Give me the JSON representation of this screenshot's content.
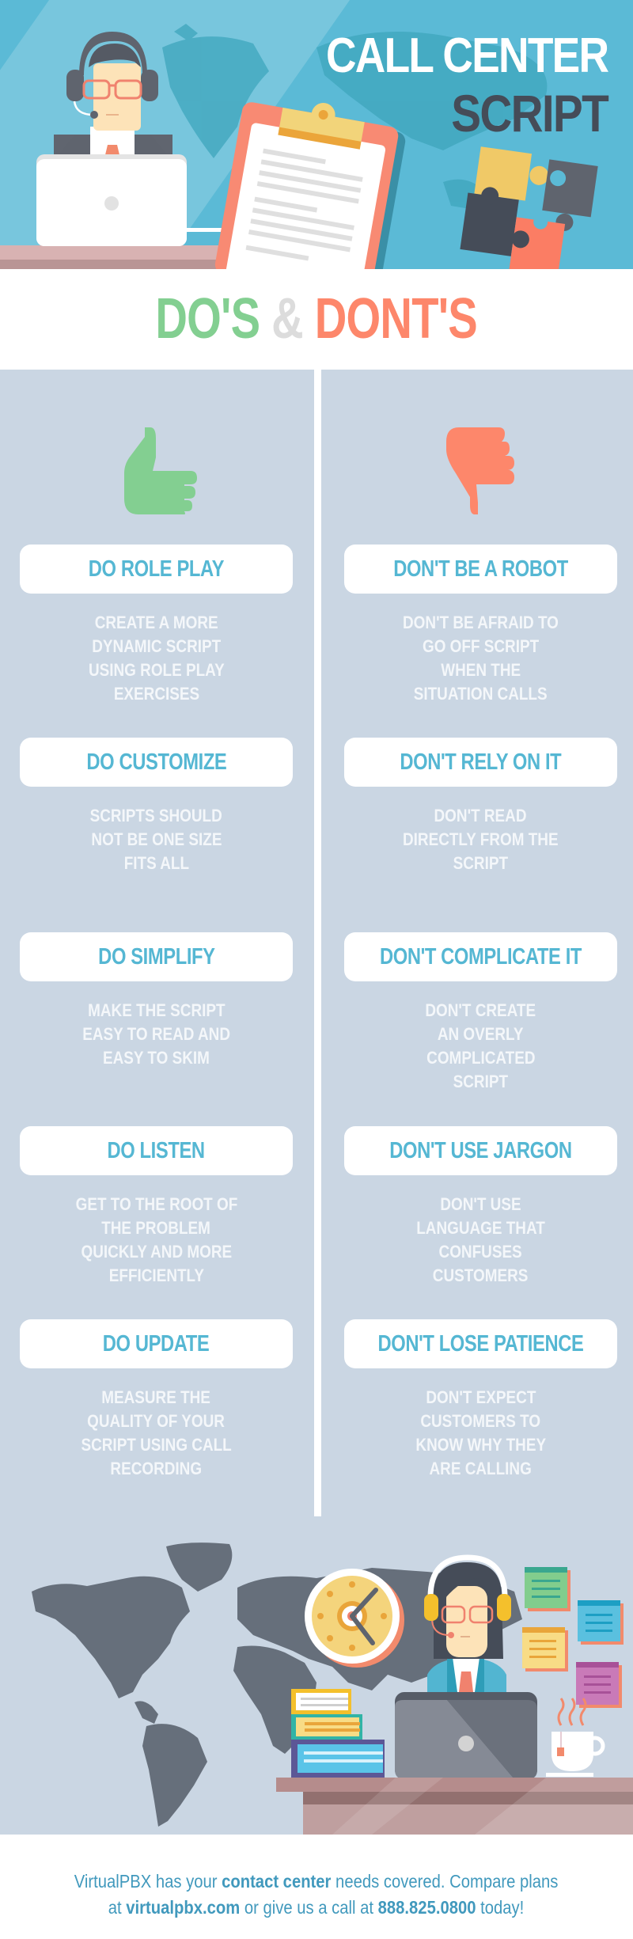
{
  "header": {
    "title_line1": "CALL CENTER",
    "title_line2": "SCRIPT"
  },
  "subheading": {
    "dos": "DO'S",
    "amp": "&",
    "donts": "DONT'S"
  },
  "icons": {
    "left": "thumbs-up-icon",
    "right": "thumbs-down-icon"
  },
  "colors": {
    "header_bg": "#5bbad6",
    "dos_green": "#83cf91",
    "donts_coral": "#fd876b",
    "card_text": "#55b7d3",
    "panel_bg": "#cad6e3",
    "footer_text": "#4199bd"
  },
  "dos": [
    {
      "title": "DO ROLE PLAY",
      "lines": [
        "CREATE A MORE",
        "DYNAMIC SCRIPT",
        "USING ROLE PLAY",
        "EXERCISES"
      ]
    },
    {
      "title": "DO CUSTOMIZE",
      "lines": [
        "SCRIPTS SHOULD",
        "NOT BE ONE SIZE",
        "FITS ALL"
      ]
    },
    {
      "title": "DO SIMPLIFY",
      "lines": [
        "MAKE THE SCRIPT",
        "EASY TO READ AND",
        "EASY TO SKIM"
      ]
    },
    {
      "title": "DO LISTEN",
      "lines": [
        "GET TO THE ROOT OF",
        "THE PROBLEM",
        "QUICKLY AND MORE",
        "EFFICIENTLY"
      ]
    },
    {
      "title": "DO UPDATE",
      "lines": [
        "MEASURE THE",
        "QUALITY OF YOUR",
        "SCRIPT USING CALL",
        "RECORDING"
      ]
    }
  ],
  "donts": [
    {
      "title": "DON'T BE A ROBOT",
      "lines": [
        "DON'T BE AFRAID TO",
        "GO OFF SCRIPT",
        "WHEN THE",
        "SITUATION CALLS"
      ]
    },
    {
      "title": "DON'T RELY ON IT",
      "lines": [
        "DON'T READ",
        "DIRECTLY FROM THE",
        "SCRIPT"
      ]
    },
    {
      "title": "DON'T COMPLICATE IT",
      "lines": [
        "DON'T CREATE",
        "AN OVERLY",
        "COMPLICATED",
        "SCRIPT"
      ]
    },
    {
      "title": "DON'T USE JARGON",
      "lines": [
        "DON'T USE",
        "LANGUAGE THAT",
        "CONFUSES",
        "CUSTOMERS"
      ]
    },
    {
      "title": "DON'T LOSE PATIENCE",
      "lines": [
        "DON'T EXPECT",
        "CUSTOMERS TO",
        "KNOW WHY THEY",
        "ARE CALLING"
      ]
    }
  ],
  "footer": {
    "p1": "VirtualPBX has your ",
    "b1": "contact center",
    "p2": " needs covered. Compare plans",
    "p3": "at ",
    "b2": "virtualpbx.com",
    "p4": " or give us a call at ",
    "b3": "888.825.0800",
    "p5": " today!"
  }
}
